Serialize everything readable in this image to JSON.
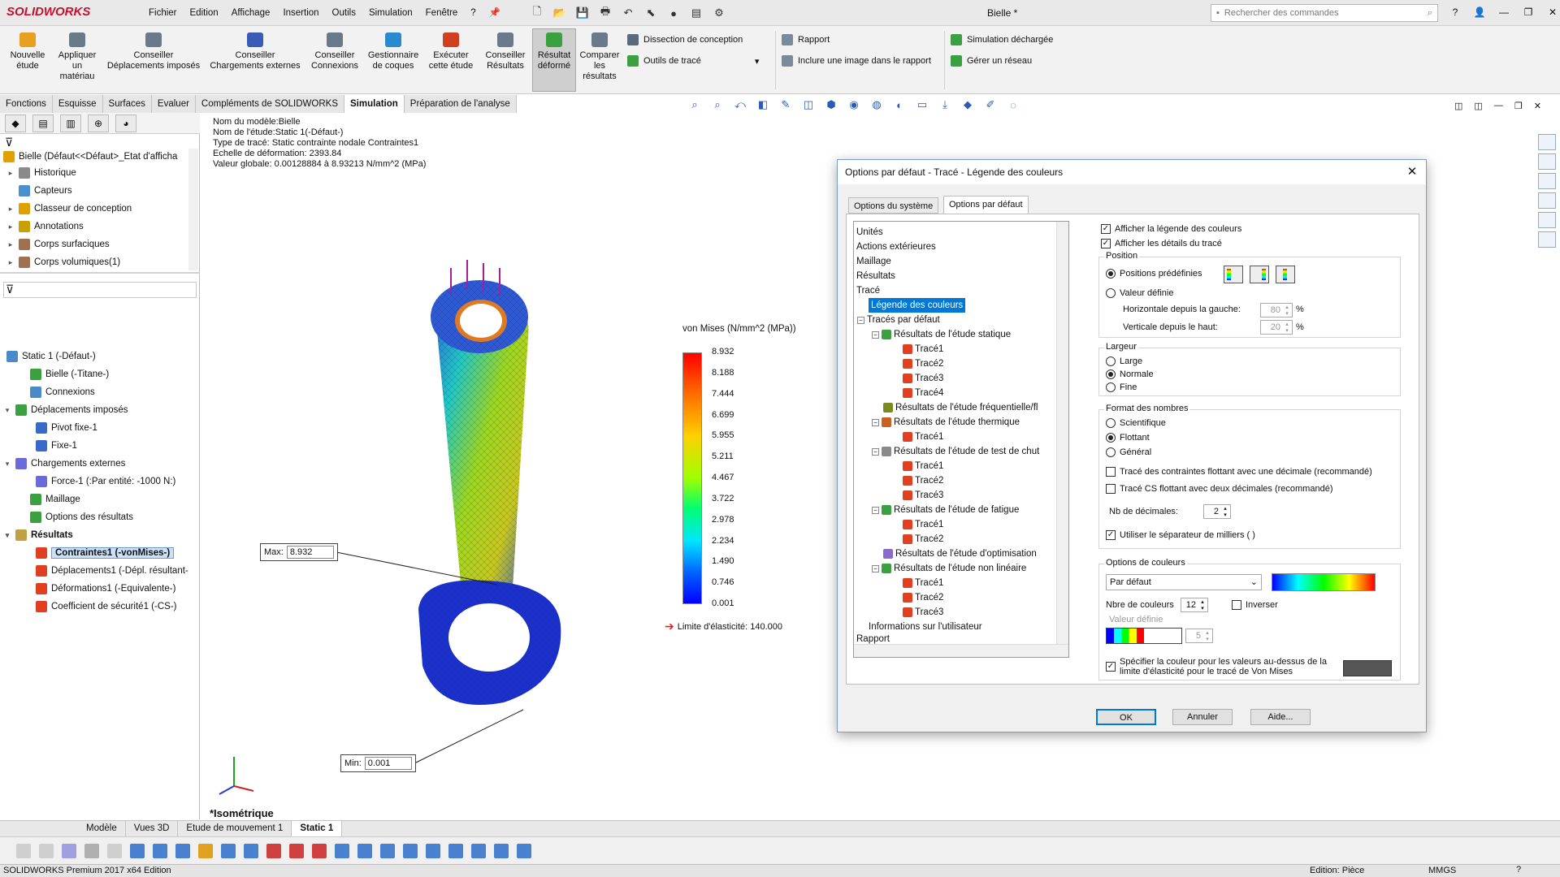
{
  "app": {
    "brand": "SOLIDWORKS",
    "menus": [
      "Fichier",
      "Edition",
      "Affichage",
      "Insertion",
      "Outils",
      "Simulation",
      "Fenêtre",
      "?"
    ],
    "doc_title": "Bielle *",
    "search_placeholder": "Rechercher des commandes"
  },
  "ribbon": {
    "buttons": [
      {
        "label": "Nouvelle\nétude",
        "color": "#e7a020"
      },
      {
        "label": "Appliquer\nun\nmatériau",
        "color": "#6a7a8a"
      },
      {
        "label": "Conseiller\nDéplacements imposés",
        "color": "#6a7a8a"
      },
      {
        "label": "Conseiller\nChargements externes",
        "color": "#3a5ab8"
      },
      {
        "label": "Conseiller\nConnexions",
        "color": "#6a7a8a"
      },
      {
        "label": "Gestionnaire\nde coques",
        "color": "#2a8ad0"
      },
      {
        "label": "Exécuter\ncette étude",
        "color": "#d04020"
      },
      {
        "label": "Conseiller\nRésultats",
        "color": "#6a7a8a"
      },
      {
        "label": "Résultat\ndéformé",
        "color": "#3aa040"
      },
      {
        "label": "Comparer\nles\nrésultats",
        "color": "#6a7a8a"
      }
    ],
    "small": [
      "Dissection de conception",
      "Outils de tracé",
      "Rapport",
      "Inclure une image dans le rapport",
      "Simulation déchargée",
      "Gérer un réseau"
    ]
  },
  "cmdtabs": [
    "Fonctions",
    "Esquisse",
    "Surfaces",
    "Evaluer",
    "Compléments de SOLIDWORKS",
    "Simulation",
    "Préparation de l'analyse"
  ],
  "feature_tree": [
    {
      "label": "Bielle  (Défaut<<Défaut>_Etat d'afficha",
      "icon": "#e0a000"
    },
    {
      "label": "Historique",
      "icon": "#8a8a8a"
    },
    {
      "label": "Capteurs",
      "icon": "#4a90d0"
    },
    {
      "label": "Classeur de conception",
      "icon": "#e0a000"
    },
    {
      "label": "Annotations",
      "icon": "#c8a000"
    },
    {
      "label": "Corps surfaciques",
      "icon": "#a07050"
    },
    {
      "label": "Corps volumiques(1)",
      "icon": "#a07050"
    }
  ],
  "sim_tree": [
    {
      "label": "Static 1 (-Défaut-)",
      "icon": "#4a8ac8"
    },
    {
      "label": "Bielle (-Titane-)",
      "icon": "#3aa040"
    },
    {
      "label": "Connexions",
      "icon": "#4a8ac8"
    },
    {
      "label": "Déplacements imposés",
      "icon": "#3aa040"
    },
    {
      "label": "Pivot fixe-1",
      "icon": "#3a6ac8"
    },
    {
      "label": "Fixe-1",
      "icon": "#3a6ac8"
    },
    {
      "label": "Chargements externes",
      "icon": "#6a6ad8"
    },
    {
      "label": "Force-1 (:Par entité: -1000 N:)",
      "icon": "#6a6ad8"
    },
    {
      "label": "Maillage",
      "icon": "#3aa040"
    },
    {
      "label": "Options des résultats",
      "icon": "#3aa040"
    },
    {
      "label": "Résultats",
      "icon": "#c0a040"
    },
    {
      "label": "Contraintes1 (-vonMises-)",
      "icon": "#e04020"
    },
    {
      "label": "Déplacements1 (-Dépl. résultant-",
      "icon": "#e04020"
    },
    {
      "label": "Déformations1 (-Equivalente-)",
      "icon": "#e04020"
    },
    {
      "label": "Coefficient de sécurité1 (-CS-)",
      "icon": "#e04020"
    }
  ],
  "plot_info": [
    "Nom du modèle:Bielle",
    "Nom de l'étude:Static 1(-Défaut-)",
    "Type de tracé: Static contrainte nodale Contraintes1",
    "Echelle de déformation: 2393.84",
    "Valeur globale: 0.00128884 à 8.93213 N/mm^2 (MPa)"
  ],
  "legend": {
    "title": "von Mises (N/mm^2 (MPa))",
    "values": [
      "8.932",
      "8.188",
      "7.444",
      "6.699",
      "5.955",
      "5.211",
      "4.467",
      "3.722",
      "2.978",
      "2.234",
      "1.490",
      "0.746",
      "0.001"
    ],
    "yield": "Limite d'élasticité: 140.000"
  },
  "callouts": {
    "max_label": "Max:",
    "max_value": "8.932",
    "min_label": "Min:",
    "min_value": "0.001"
  },
  "view_label": "*Isométrique",
  "bottom_tabs": [
    "Modèle",
    "Vues 3D",
    "Etude de mouvement 1",
    "Static 1"
  ],
  "status": {
    "left": "SOLIDWORKS Premium 2017 x64 Edition",
    "edition": "Edition: Pièce",
    "units": "MMGS"
  },
  "dialog": {
    "title": "Options par défaut - Tracé - Légende des couleurs",
    "tabs": [
      "Options du système",
      "Options par défaut"
    ],
    "tree": [
      "Unités",
      "Actions extérieures",
      "Maillage",
      "Résultats",
      "Tracé",
      "Légende des couleurs",
      "Tracés par défaut",
      "Résultats de l'étude statique",
      "Tracé1",
      "Tracé2",
      "Tracé3",
      "Tracé4",
      "Résultats de l'étude fréquentielle/fl",
      "Résultats de l'étude thermique",
      "Tracé1",
      "Résultats de l'étude de test de chut",
      "Tracé1",
      "Tracé2",
      "Tracé3",
      "Résultats de l'étude de fatigue",
      "Tracé1",
      "Tracé2",
      "Résultats de l'étude d'optimisation",
      "Résultats de l'étude non linéaire",
      "Tracé1",
      "Tracé2",
      "Tracé3",
      "Informations sur l'utilisateur",
      "Rapport"
    ],
    "chk_show_legend": "Afficher la légende des couleurs",
    "chk_show_details": "Afficher les détails du tracé",
    "position_title": "Position",
    "pos_predef": "Positions prédéfinies",
    "pos_defined": "Valeur définie",
    "horiz_label": "Horizontale depuis la gauche:",
    "horiz_value": "80",
    "vert_label": "Verticale depuis le haut:",
    "vert_value": "20",
    "pct": "%",
    "width_title": "Largeur",
    "width_options": [
      "Large",
      "Normale",
      "Fine"
    ],
    "numfmt_title": "Format des nombres",
    "numfmt_options": [
      "Scientifique",
      "Flottant",
      "Général"
    ],
    "chk_float_one": "Tracé des contraintes flottant avec une décimale (recommandé)",
    "chk_float_two": "Tracé CS flottant avec deux décimales (recommandé)",
    "decimals_label": "Nb de décimales:",
    "decimals_value": "2",
    "chk_thousands": "Utiliser le séparateur de milliers ( )",
    "color_title": "Options de couleurs",
    "color_select": "Par défaut",
    "ncolors_label": "Nbre de couleurs",
    "ncolors_value": "12",
    "invert_label": "Inverser",
    "defined_value_label": "Valeur définie",
    "defined_value": "5",
    "chk_above_yield": "Spécifier la couleur pour les valeurs au-dessus de la limite d'élasticité pour le tracé de Von Mises",
    "above_yield_color": "#555555",
    "ok": "OK",
    "cancel": "Annuler",
    "help": "Aide..."
  }
}
